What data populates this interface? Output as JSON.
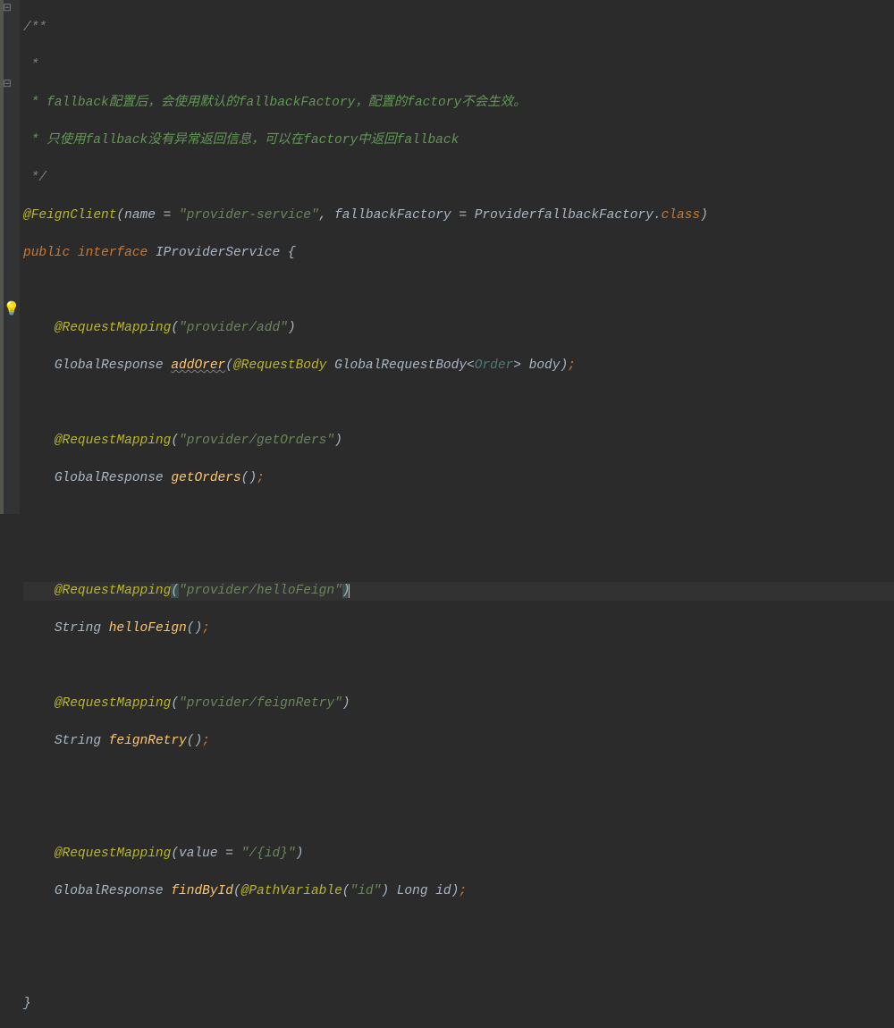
{
  "comment": {
    "open": "/**",
    "star": " *",
    "line1a": " * fallback",
    "line1b": "配置后，会使用默认的",
    "line1c": "fallbackFactory",
    "line1d": "，配置的",
    "line1e": "factory",
    "line1f": "不会生效。",
    "line2a": " * 只使用",
    "line2b": "fallback",
    "line2c": "没有异常返回信息，可以在",
    "line2d": "factory",
    "line2e": "中返回",
    "line2f": "fallback",
    "close": " */"
  },
  "feign": {
    "ann": "@FeignClient",
    "open": "(",
    "nameK": "name = ",
    "nameV": "\"provider-service\"",
    "sep": ", ",
    "fbK": "fallbackFactory = ",
    "fbV": "ProviderfallbackFactory",
    "dot": ".",
    "classKw": "class",
    "close": ")"
  },
  "decl": {
    "pub": "public ",
    "intf": "interface ",
    "name": "IProviderService ",
    "brace": "{"
  },
  "m1": {
    "ann": "@RequestMapping",
    "o": "(",
    "v": "\"provider/add\"",
    "c": ")",
    "ret": "GlobalResponse ",
    "name": "addOrer",
    "po": "(",
    "bodyAnn": "@RequestBody",
    "sp": " ",
    "ptype": "GlobalRequestBody<",
    "generic": "Order",
    "gt": "> ",
    "param": "body)",
    "semi": ";"
  },
  "m2": {
    "ann": "@RequestMapping",
    "o": "(",
    "v": "\"provider/getOrders\"",
    "c": ")",
    "ret": "GlobalResponse ",
    "name": "getOrders",
    "tail": "()",
    "semi": ";"
  },
  "m3": {
    "ann": "@RequestMapping",
    "o": "(",
    "v": "\"provider/helloFeign\"",
    "c": ")",
    "ret": "String ",
    "name": "helloFeign",
    "tail": "()",
    "semi": ";"
  },
  "m4": {
    "ann": "@RequestMapping",
    "o": "(",
    "v": "\"provider/feignRetry\"",
    "c": ")",
    "ret": "String ",
    "name": "feignRetry",
    "tail": "()",
    "semi": ";"
  },
  "m5": {
    "ann": "@RequestMapping",
    "o": "(",
    "vk": "value = ",
    "v": "\"/{id}\"",
    "c": ")",
    "ret": "GlobalResponse ",
    "name": "findById",
    "po": "(",
    "pvAnn": "@PathVariable",
    "pvo": "(",
    "pvv": "\"id\"",
    "pvc": ") ",
    "ptype": "Long ",
    "param": "id)",
    "semi": ";"
  },
  "closeBrace": "}",
  "bulb": "💡"
}
